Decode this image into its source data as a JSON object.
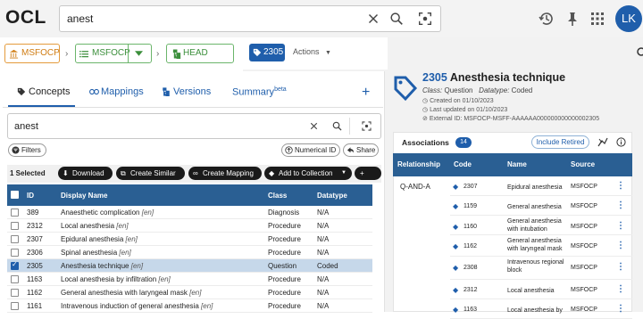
{
  "app": {
    "logo": "OCL",
    "search_value": "anest",
    "avatar_initials": "LK"
  },
  "colors": {
    "brand": "#1f5eab",
    "table_header": "#2a5f93",
    "org": "#d07d14",
    "source": "#3c8f3c"
  },
  "breadcrumbs": {
    "org": "MSFOCP",
    "source": "MSFOCP",
    "version": "HEAD"
  },
  "version_bar": {
    "version": "2305",
    "actions_label": "Actions"
  },
  "tabs": [
    {
      "label": "Concepts",
      "icon": "tag-icon"
    },
    {
      "label": "Mappings",
      "icon": "link-icon"
    },
    {
      "label": "Versions",
      "icon": "versions-icon"
    },
    {
      "label": "Summary",
      "sup": "beta"
    }
  ],
  "concept_search": {
    "value": "anest"
  },
  "filters": {
    "filters_label": "Filters",
    "numerical_id_label": "Numerical ID",
    "share_label": "Share"
  },
  "selection": {
    "count_label": "1 Selected",
    "download_label": "Download",
    "create_similar_label": "Create Similar",
    "create_mapping_label": "Create Mapping",
    "add_to_collection_label": "Add to Collection"
  },
  "table": {
    "headers": {
      "id": "ID",
      "display_name": "Display Name",
      "class": "Class",
      "datatype": "Datatype"
    },
    "rows": [
      {
        "id": "389",
        "name": "Anaesthetic complication",
        "lang": "[en]",
        "class": "Diagnosis",
        "datatype": "N/A",
        "selected": false
      },
      {
        "id": "2312",
        "name": "Local anesthesia",
        "lang": "[en]",
        "class": "Procedure",
        "datatype": "N/A",
        "selected": false
      },
      {
        "id": "2307",
        "name": "Epidural anesthesia",
        "lang": "[en]",
        "class": "Procedure",
        "datatype": "N/A",
        "selected": false
      },
      {
        "id": "2306",
        "name": "Spinal anesthesia",
        "lang": "[en]",
        "class": "Procedure",
        "datatype": "N/A",
        "selected": false
      },
      {
        "id": "2305",
        "name": "Anesthesia technique",
        "lang": "[en]",
        "class": "Question",
        "datatype": "Coded",
        "selected": true
      },
      {
        "id": "1163",
        "name": "Local anesthesia by infiltration",
        "lang": "[en]",
        "class": "Procedure",
        "datatype": "N/A",
        "selected": false
      },
      {
        "id": "1162",
        "name": "General anesthesia with laryngeal mask",
        "lang": "[en]",
        "class": "Procedure",
        "datatype": "N/A",
        "selected": false
      },
      {
        "id": "1161",
        "name": "Intravenous induction of general anesthesia",
        "lang": "[en]",
        "class": "Procedure",
        "datatype": "N/A",
        "selected": false
      }
    ]
  },
  "detail": {
    "code": "2305",
    "title": "Anesthesia technique",
    "class_label": "Class:",
    "class_value": "Question",
    "datatype_label": "Datatype:",
    "datatype_value": "Coded",
    "created": "Created on 01/10/2023",
    "updated": "Last updated on 01/10/2023",
    "external_id": "External ID: MSFOCP-MSFF-AAAAAA000000000000002305"
  },
  "associations": {
    "title": "Associations",
    "count": "14",
    "include_retired_label": "Include Retired",
    "headers": {
      "relationship": "Relationship",
      "code": "Code",
      "name": "Name",
      "source": "Source"
    },
    "relationship": "Q-AND-A",
    "rows": [
      {
        "code": "2307",
        "name": [
          "Epidural anesthesia"
        ],
        "source": "MSFOCP"
      },
      {
        "code": "1159",
        "name": [
          "General anesthesia"
        ],
        "source": "MSFOCP"
      },
      {
        "code": "1160",
        "name": [
          "General anesthesia",
          "with intubation"
        ],
        "source": "MSFOCP"
      },
      {
        "code": "1162",
        "name": [
          "General anesthesia",
          "with laryngeal mask"
        ],
        "source": "MSFOCP"
      },
      {
        "code": "2308",
        "name": [
          "Intravenous regional",
          "block"
        ],
        "source": "MSFOCP"
      },
      {
        "code": "2312",
        "name": [
          "Local anesthesia"
        ],
        "source": "MSFOCP"
      },
      {
        "code": "1163",
        "name": [
          "Local anesthesia by"
        ],
        "source": "MSFOCP"
      }
    ]
  }
}
